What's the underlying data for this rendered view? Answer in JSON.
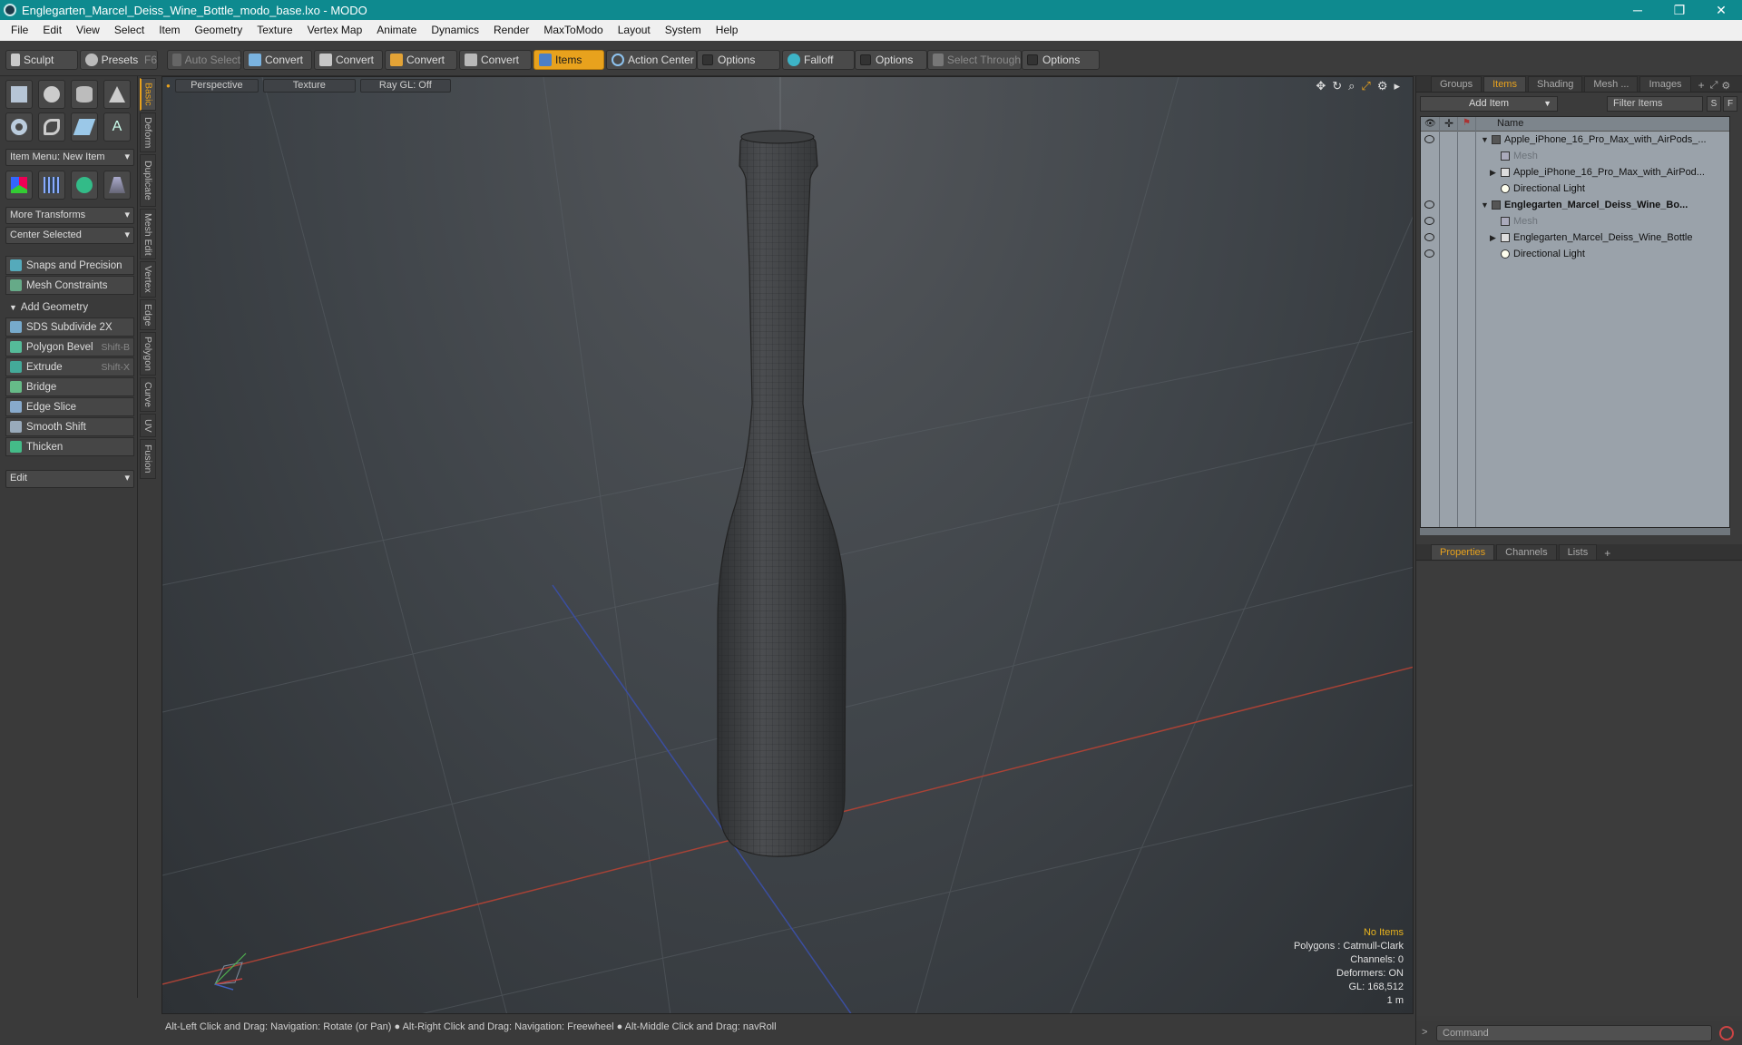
{
  "window": {
    "title": "Englegarten_Marcel_Deiss_Wine_Bottle_modo_base.lxo - MODO",
    "minimize": "─",
    "restore": "❐",
    "close": "✕"
  },
  "menu": [
    "File",
    "Edit",
    "View",
    "Select",
    "Item",
    "Geometry",
    "Texture",
    "Vertex Map",
    "Animate",
    "Dynamics",
    "Render",
    "MaxToModo",
    "Layout",
    "System",
    "Help"
  ],
  "toolbar": {
    "sculpt": "Sculpt",
    "presets": "Presets",
    "presets_key": "F6",
    "auto_select": "Auto Select",
    "convert1": "Convert",
    "convert2": "Convert",
    "convert3": "Convert",
    "convert4": "Convert",
    "items": "Items",
    "action_center": "Action Center",
    "options1": "Options",
    "falloff": "Falloff",
    "options2": "Options",
    "select_through": "Select Through",
    "options3": "Options"
  },
  "left": {
    "item_menu": "Item Menu: New Item",
    "more_transforms": "More Transforms",
    "center_selected": "Center Selected",
    "snaps": "Snaps and Precision",
    "mesh_constraints": "Mesh Constraints",
    "add_geometry": "Add Geometry",
    "tools": [
      {
        "label": "SDS Subdivide 2X",
        "key": ""
      },
      {
        "label": "Polygon Bevel",
        "key": "Shift-B"
      },
      {
        "label": "Extrude",
        "key": "Shift-X"
      },
      {
        "label": "Bridge",
        "key": ""
      },
      {
        "label": "Edge Slice",
        "key": ""
      },
      {
        "label": "Smooth Shift",
        "key": ""
      },
      {
        "label": "Thicken",
        "key": ""
      }
    ],
    "edit": "Edit"
  },
  "vtabs": [
    "Basic",
    "Deform",
    "Duplicate",
    "Mesh Edit",
    "Vertex",
    "Edge",
    "Polygon",
    "Curve",
    "UV",
    "Fusion"
  ],
  "viewport": {
    "view": "Perspective",
    "shading": "Texture",
    "raygl": "Ray GL: Off",
    "hud": {
      "items": "No Items",
      "polygons": "Polygons : Catmull-Clark",
      "channels": "Channels: 0",
      "deformers": "Deformers: ON",
      "gl": "GL: 168,512",
      "scale": "1 m"
    }
  },
  "status": "Alt-Left Click and Drag: Navigation: Rotate (or Pan) ● Alt-Right Click and Drag: Navigation: Freewheel ● Alt-Middle Click and Drag: navRoll",
  "right": {
    "tabs": [
      "Groups",
      "Items",
      "Shading",
      "Mesh ...",
      "Images"
    ],
    "add_item": "Add Item",
    "filter": "Filter Items",
    "s": "S",
    "f": "F",
    "col_name": "Name",
    "tree": [
      {
        "label": "Apple_iPhone_16_Pro_Max_with_AirPods_...",
        "style": "",
        "indent": 0,
        "arrow": "▼",
        "eye": true
      },
      {
        "label": "Mesh",
        "style": "dim",
        "indent": 2,
        "arrow": "",
        "eye": false
      },
      {
        "label": "Apple_iPhone_16_Pro_Max_with_AirPod...",
        "style": "",
        "indent": 1,
        "arrow": "▶",
        "eye": false
      },
      {
        "label": "Directional Light",
        "style": "",
        "indent": 1,
        "arrow": "",
        "eye": false
      },
      {
        "label": "Englegarten_Marcel_Deiss_Wine_Bo...",
        "style": "bold",
        "indent": 0,
        "arrow": "▼",
        "eye": true
      },
      {
        "label": "Mesh",
        "style": "dim",
        "indent": 2,
        "arrow": "",
        "eye": true
      },
      {
        "label": "Englegarten_Marcel_Deiss_Wine_Bottle",
        "style": "",
        "indent": 1,
        "arrow": "▶",
        "eye": true
      },
      {
        "label": "Directional Light",
        "style": "",
        "indent": 1,
        "arrow": "",
        "eye": true
      }
    ],
    "bottom_tabs": [
      "Properties",
      "Channels",
      "Lists"
    ],
    "command": "Command"
  }
}
